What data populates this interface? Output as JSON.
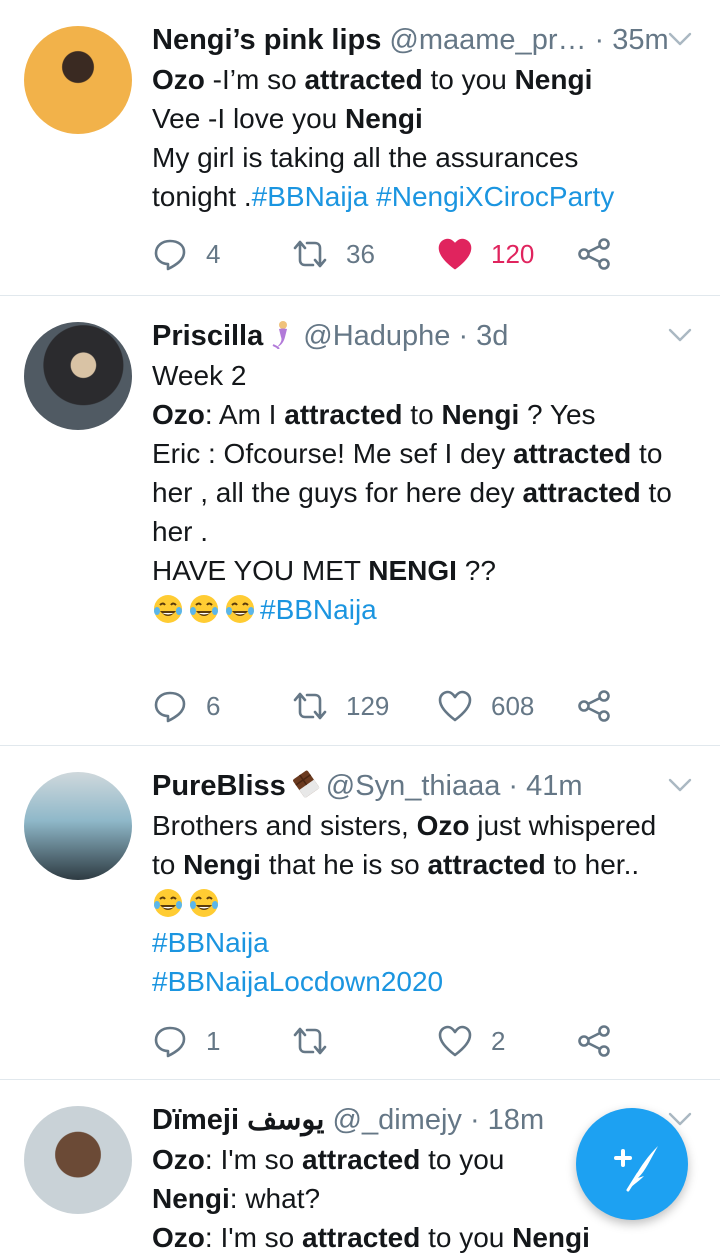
{
  "tweets": [
    {
      "name": "Nengi’s pink lips",
      "handle": "@maame_pr…",
      "time": "· 35m",
      "lines": [
        [
          {
            "t": "Ozo",
            "b": true
          },
          {
            "t": " -I’m so "
          },
          {
            "t": "attracted",
            "b": true
          },
          {
            "t": " to you "
          },
          {
            "t": "Nengi",
            "b": true
          }
        ],
        [
          {
            "t": "Vee -I love you "
          },
          {
            "t": "Nengi",
            "b": true
          }
        ],
        [
          {
            "t": "My girl is taking all the assurances"
          }
        ],
        [
          {
            "t": "tonight ."
          },
          {
            "t": "#BBNaija",
            "tag": true
          },
          {
            "t": " "
          },
          {
            "t": "#NengiXCirocParty",
            "tag": true
          }
        ]
      ],
      "replies": "4",
      "retweets": "36",
      "likes": "120",
      "liked": true
    },
    {
      "name": "Priscilla",
      "handle": "@Haduphe",
      "time": "· 3d",
      "lines": [
        [
          {
            "t": "Week 2"
          }
        ],
        [
          {
            "t": "Ozo",
            "b": true
          },
          {
            "t": ": Am I "
          },
          {
            "t": "attracted",
            "b": true
          },
          {
            "t": " to "
          },
          {
            "t": "Nengi",
            "b": true
          },
          {
            "t": " ? Yes"
          }
        ],
        [
          {
            "t": "Eric : Ofcourse! Me sef I dey "
          },
          {
            "t": "attracted",
            "b": true
          },
          {
            "t": " to"
          }
        ],
        [
          {
            "t": "her , all the guys for here dey "
          },
          {
            "t": "attracted",
            "b": true
          },
          {
            "t": " to"
          }
        ],
        [
          {
            "t": "her ."
          }
        ],
        [
          {
            "t": " "
          }
        ],
        [
          {
            "t": "HAVE YOU MET "
          },
          {
            "t": "NENGI",
            "b": true
          },
          {
            "t": " ??"
          }
        ],
        [
          {
            "emoji": 3
          },
          {
            "t": "#BBNaija",
            "tag": true
          }
        ]
      ],
      "replies": "6",
      "retweets": "129",
      "likes": "608",
      "liked": false
    },
    {
      "name": "PureBliss",
      "handle": "@Syn_thiaaa",
      "time": "· 41m",
      "lines": [
        [
          {
            "t": "Brothers and sisters, "
          },
          {
            "t": "Ozo",
            "b": true
          },
          {
            "t": " just whispered"
          }
        ],
        [
          {
            "t": "to "
          },
          {
            "t": "Nengi",
            "b": true
          },
          {
            "t": " that he is so "
          },
          {
            "t": "attracted",
            "b": true
          },
          {
            "t": " to her.."
          }
        ],
        [
          {
            "emoji": 2
          }
        ],
        [
          {
            "t": "#BBNaija",
            "tag": true
          }
        ],
        [
          {
            "t": "#BBNaijaLocdown2020",
            "tag": true
          }
        ]
      ],
      "replies": "1",
      "retweets": "",
      "likes": "2",
      "liked": false
    },
    {
      "name": "Dïmeji يوسف",
      "handle": "@_dimejy",
      "time": "· 18m",
      "lines": [
        [
          {
            "t": "Ozo",
            "b": true
          },
          {
            "t": ": I'm so "
          },
          {
            "t": "attracted",
            "b": true
          },
          {
            "t": " to you"
          }
        ],
        [
          {
            "t": "Nengi",
            "b": true
          },
          {
            "t": ": what?"
          }
        ],
        [
          {
            "t": "Ozo",
            "b": true
          },
          {
            "t": ": I'm so "
          },
          {
            "t": "attracted",
            "b": true
          },
          {
            "t": " to you "
          },
          {
            "t": "Nengi",
            "b": true
          }
        ]
      ],
      "replies": "",
      "retweets": "",
      "likes": "",
      "liked": false
    }
  ],
  "colors": {
    "accent": "#1da1f2",
    "link": "#1b95e0",
    "like": "#e0245e",
    "muted": "#657786"
  },
  "fab": {
    "icon": "compose-feather-icon"
  }
}
